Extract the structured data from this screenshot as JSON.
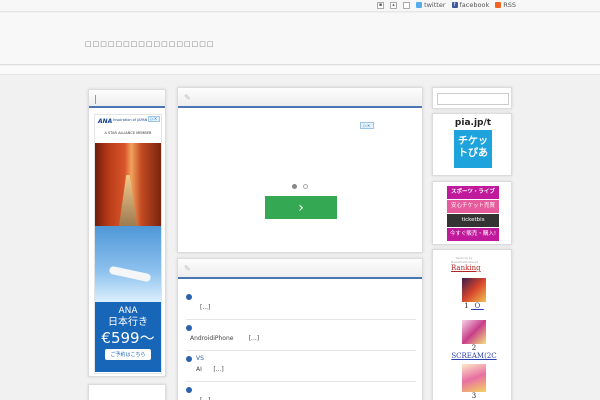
{
  "topbar": {
    "twitter_label": "twitter",
    "facebook_label": "facebook",
    "rss_label": "RSS"
  },
  "header": {
    "site_title": "□□□□□□□□□□□□□□□□□"
  },
  "main": {
    "carousel_button_label": "›",
    "posts": [
      {
        "title": "",
        "excerpt": "[...]"
      },
      {
        "title": "",
        "excerpt": "AndroidiPhone        [...]"
      },
      {
        "title": "VS",
        "excerpt": "AI      [...]"
      },
      {
        "title": "",
        "excerpt": "[...]"
      }
    ]
  },
  "ana_ad": {
    "logo": "ANA",
    "tagline": "Inspiration of JAPAN",
    "alliance": "A STAR ALLIANCE MEMBER",
    "line1": "ANA",
    "line2": "日本行き",
    "price": "€599〜",
    "cta": "ご予約はこちら"
  },
  "right": {
    "pia_url": "pia.jp/t",
    "pia_logo": "チケットぴあ",
    "ticket_ad": [
      "スポーツ・ライブ",
      "安心チケット売買",
      "ticketbis",
      "今すぐ販売・購入!"
    ],
    "ranking_sub": "Ranking by NewsPostPowered",
    "ranking_title": "Ranking",
    "rank_items": [
      {
        "label": "1",
        "link": "_O_"
      },
      {
        "label": "2",
        "link": "SCREAM(2C"
      },
      {
        "label": "3",
        "link": ""
      }
    ]
  },
  "colors": {
    "accent": "#4a77b4",
    "link": "#2a62b0",
    "button_green": "#34a853",
    "ana_blue": "#1866b8"
  }
}
